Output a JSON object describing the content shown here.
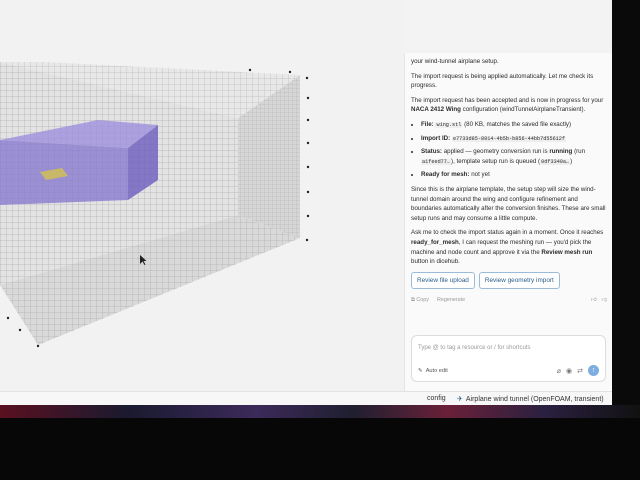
{
  "viewport": {
    "label": "3D mesh preview"
  },
  "chat": {
    "intro_fragment": "your wind-tunnel airplane setup.",
    "msg1": "The import request is being applied automatically. Let me check its progress.",
    "msg2_a": "The import request has been accepted and is now in progress for your ",
    "msg2_bold": "NACA 2412 Wing",
    "msg2_b": " configuration (windTunnelAirplaneTransient).",
    "file_label": "File:",
    "file_name": "wing.stl",
    "file_note": "(80 KB, matches the saved file exactly)",
    "import_label": "Import ID:",
    "import_id": "e7733d85-8914-4b5b-b856-44bb7d55612f",
    "status_label": "Status:",
    "status_a": "applied — geometry conversion run is ",
    "status_running": "running",
    "status_b": " (run ",
    "status_run_id": "a1feed77…",
    "status_c": "), template setup run is queued (",
    "status_queued_id": "0df3340a…",
    "status_d": ")",
    "ready_label": "Ready for mesh:",
    "ready_value": "not yet",
    "msg3": "Since this is the airplane template, the setup step will size the wind-tunnel domain around the wing and configure refinement and boundaries automatically after the conversion finishes. These are small setup runs and may consume a little compute.",
    "msg4_a": "Ask me to check the import status again in a moment. Once it reaches ",
    "msg4_bold1": "ready_for_mesh",
    "msg4_b": ", I can request the meshing run — you'd pick the machine and node count and approve it via the ",
    "msg4_bold2": "Review mesh run",
    "msg4_c": " button in dicehub.",
    "btn_review_file": "Review file upload",
    "btn_review_geometry": "Review geometry import",
    "copy": "Copy",
    "regenerate": "Regenerate"
  },
  "composer": {
    "placeholder": "Type @ to tag a resource or / for shortcuts",
    "auto_edit": "Auto edit"
  },
  "statusbar": {
    "config": "config",
    "simulation": "Airplane wind tunnel (OpenFOAM, transient)"
  },
  "colors": {
    "accent": "#2a5e8c",
    "wing_box": "#7b6fc4",
    "wing": "#c9b86a"
  }
}
